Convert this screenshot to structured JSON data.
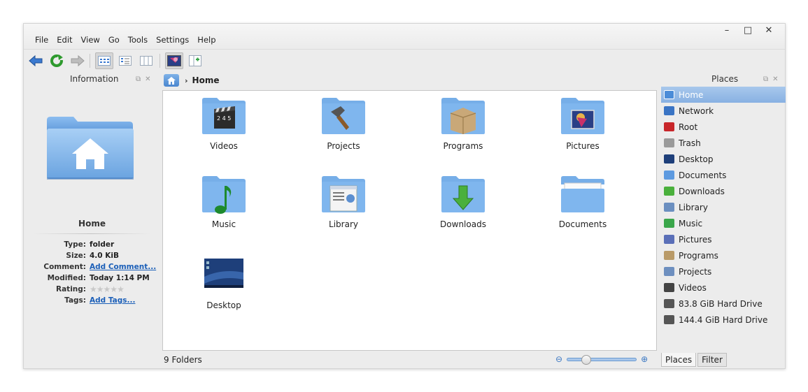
{
  "window": {
    "controls": [
      "–",
      "□",
      "✕"
    ]
  },
  "menu": [
    "File",
    "Edit",
    "View",
    "Go",
    "Tools",
    "Settings",
    "Help"
  ],
  "toolbar": {
    "icons": [
      "back-icon",
      "reload-icon",
      "forward-icon",
      "icons-view-icon",
      "details-view-icon",
      "columns-view-icon",
      "preview-icon",
      "split-view-icon"
    ]
  },
  "info_panel": {
    "title": "Information",
    "name": "Home",
    "properties": [
      {
        "label": "Type:",
        "value": "folder"
      },
      {
        "label": "Size:",
        "value": "4.0 KiB"
      },
      {
        "label": "Comment:",
        "value": "Add Comment..."
      },
      {
        "label": "Modified:",
        "value": "Today 1:14 PM"
      },
      {
        "label": "Rating:",
        "value": ""
      },
      {
        "label": "Tags:",
        "value": "Add Tags..."
      }
    ],
    "rating": 0
  },
  "breadcrumb": {
    "current": "Home"
  },
  "items": [
    {
      "label": "Videos"
    },
    {
      "label": "Projects"
    },
    {
      "label": "Programs"
    },
    {
      "label": "Pictures"
    },
    {
      "label": "Music"
    },
    {
      "label": "Library"
    },
    {
      "label": "Downloads"
    },
    {
      "label": "Documents"
    },
    {
      "label": "Desktop"
    }
  ],
  "status": {
    "text": "9 Folders",
    "zoom_level": 0.2
  },
  "places_panel": {
    "title": "Places",
    "items": [
      {
        "label": "Home",
        "active": true,
        "color": "#4b8cd8"
      },
      {
        "label": "Network",
        "color": "#3a74c4"
      },
      {
        "label": "Root",
        "color": "#c8262a"
      },
      {
        "label": "Trash",
        "color": "#9a9a9a"
      },
      {
        "label": "Desktop",
        "color": "#1e3f7a"
      },
      {
        "label": "Documents",
        "color": "#5d9ae0"
      },
      {
        "label": "Downloads",
        "color": "#4ab03c"
      },
      {
        "label": "Library",
        "color": "#6b8fc0"
      },
      {
        "label": "Music",
        "color": "#3aa64a"
      },
      {
        "label": "Pictures",
        "color": "#5a6fb8"
      },
      {
        "label": "Programs",
        "color": "#b99a68"
      },
      {
        "label": "Projects",
        "color": "#6d8fbf"
      },
      {
        "label": "Videos",
        "color": "#444444"
      },
      {
        "label": "83.8 GiB Hard Drive",
        "color": "#555555"
      },
      {
        "label": "144.4 GiB Hard Drive",
        "color": "#555555"
      }
    ],
    "tabs": [
      "Places",
      "Filter"
    ]
  }
}
